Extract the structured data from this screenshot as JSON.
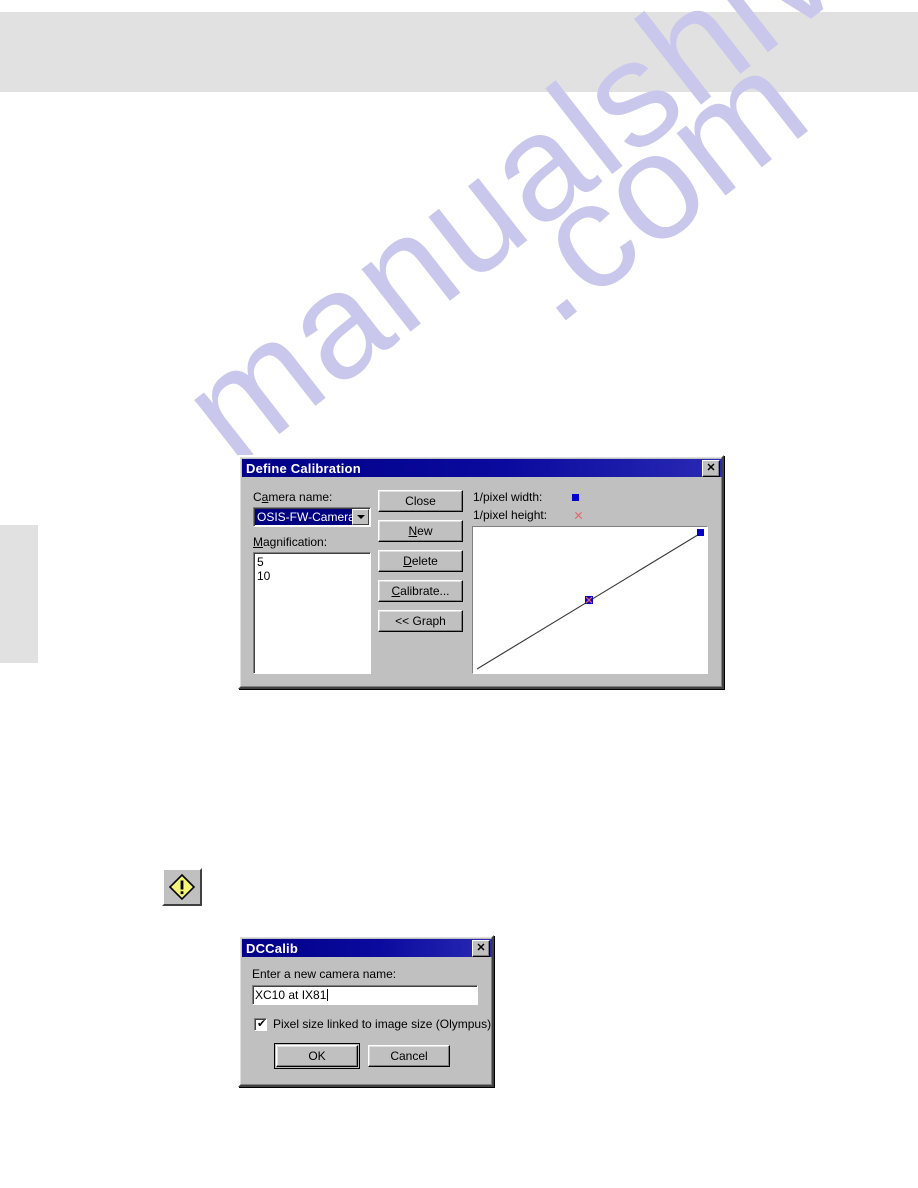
{
  "page": {
    "watermark_text_a": "manualshive",
    "watermark_text_b": ".com"
  },
  "define_calibration_dialog": {
    "title": "Define Calibration",
    "close_label": "✕",
    "camera_name_label_pre": "C",
    "camera_name_label_accel": "a",
    "camera_name_label_post": "mera name:",
    "camera_name_label_full": "Camera name:",
    "camera_name_value": "OSIS-FW-Camera",
    "magnification_label_accel": "M",
    "magnification_label_post": "agnification:",
    "magnification_label_full": "Magnification:",
    "magnification_items": [
      "5",
      "10"
    ],
    "buttons": [
      {
        "id": "close",
        "label": "Close",
        "accel": "",
        "tail": "Close"
      },
      {
        "id": "new",
        "label": "New",
        "accel": "N",
        "tail": "ew"
      },
      {
        "id": "delete",
        "label": "Delete",
        "accel": "D",
        "tail": "elete"
      },
      {
        "id": "calibrate",
        "label": "Calibrate...",
        "accel": "C",
        "tail": "alibrate..."
      },
      {
        "id": "graph",
        "label": "<< Graph",
        "accel": "",
        "tail": "<< Graph"
      }
    ],
    "legend": [
      {
        "id": "pixel-width",
        "label": "1/pixel width:",
        "marker": "square-marker",
        "color": "#0000c8"
      },
      {
        "id": "pixel-height",
        "label": "1/pixel height:",
        "marker": "x-marker",
        "color": "#e06060"
      }
    ],
    "chart_data": {
      "type": "line",
      "title": "",
      "xlabel": "",
      "ylabel": "",
      "grid": false,
      "legend_position": "above-plot",
      "xlim": [
        0,
        1
      ],
      "ylim": [
        0,
        1
      ],
      "series": [
        {
          "name": "1/pixel width",
          "marker": "square",
          "color": "#0000c8",
          "points": [
            {
              "x": 0.0,
              "y": 0.0
            },
            {
              "x": 0.5,
              "y": 0.5
            },
            {
              "x": 1.0,
              "y": 1.0
            }
          ],
          "marked_points": [
            {
              "x": 0.5,
              "y": 0.5
            },
            {
              "x": 1.0,
              "y": 1.0
            }
          ]
        },
        {
          "name": "1/pixel height",
          "marker": "x",
          "color": "#e06060",
          "points": [
            {
              "x": 0.0,
              "y": 0.0
            },
            {
              "x": 0.5,
              "y": 0.5
            },
            {
              "x": 1.0,
              "y": 1.0
            }
          ],
          "marked_points": [
            {
              "x": 0.5,
              "y": 0.5
            }
          ]
        }
      ]
    }
  },
  "caution_icon_button": {
    "icon": "warning-diamond-icon",
    "glyph": "!",
    "diamond_color": "#f4f479",
    "outline_color": "#000000"
  },
  "dccalib_dialog": {
    "title": "DCCalib",
    "close_label": "✕",
    "prompt_label": "Enter a new camera name:",
    "camera_name_value": "XC10 at IX81",
    "checkbox_label": "Pixel size linked to image size (Olympus)",
    "checkbox_checked": true,
    "checkbox_glyph": "✔",
    "ok_label": "OK",
    "cancel_label": "Cancel"
  }
}
